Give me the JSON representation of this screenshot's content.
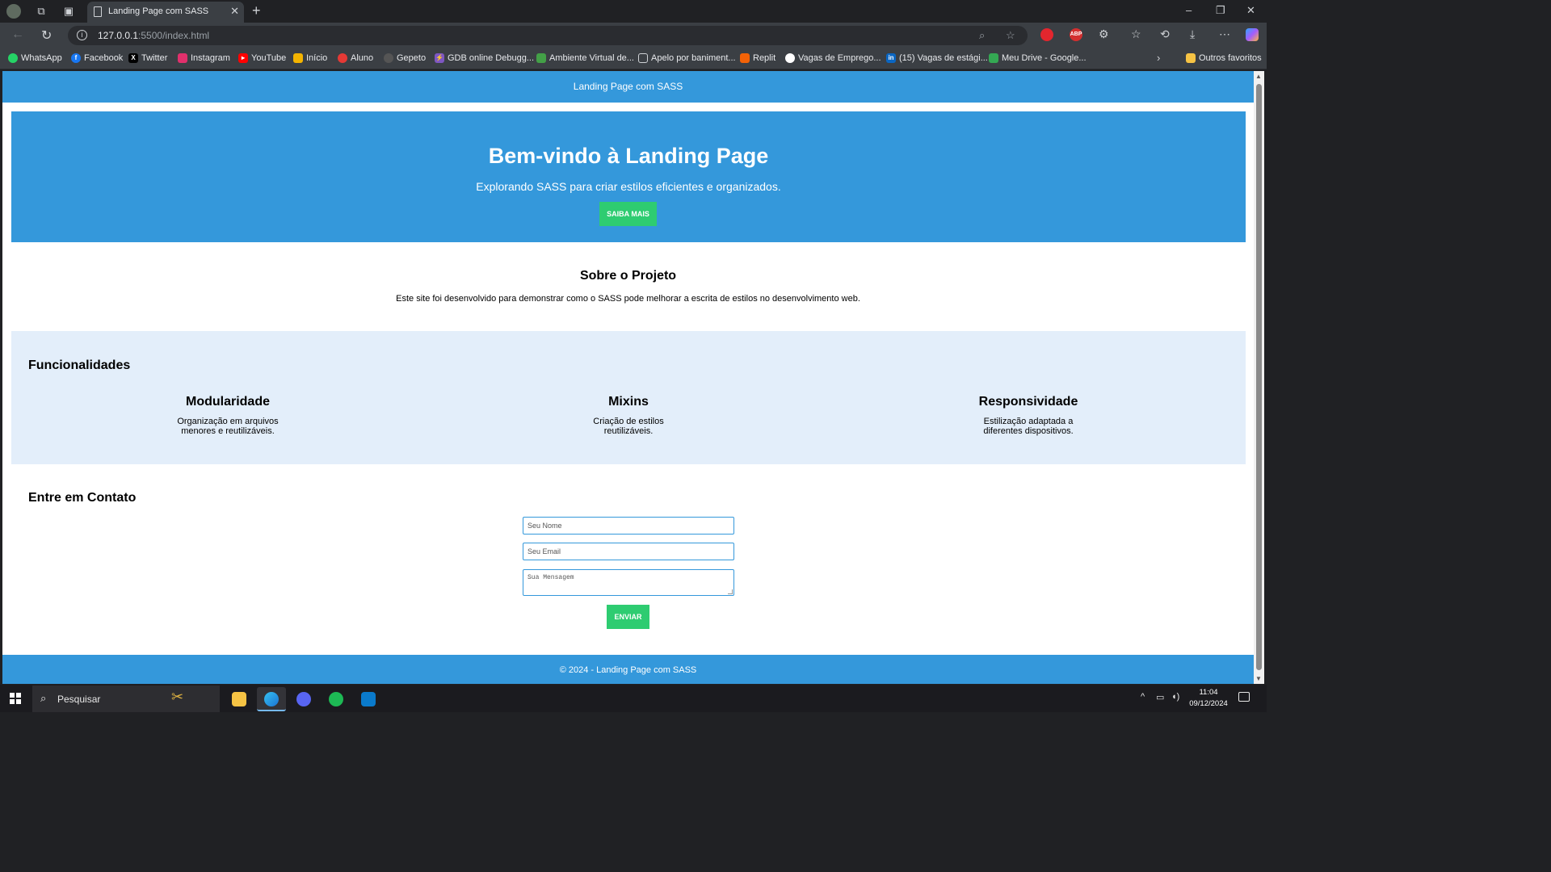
{
  "browser": {
    "tab_title": "Landing Page com SASS",
    "new_tab": "+",
    "url_host": "127.0.0.1",
    "url_path": ":5500/index.html",
    "extensions": [
      "opera-vpn",
      "ABP",
      "puzzle",
      "favorites",
      "history",
      "download",
      "more",
      "copilot"
    ],
    "window_controls": [
      "–",
      "❐",
      "✕"
    ]
  },
  "bookmarks": [
    {
      "label": "WhatsApp",
      "icon": "whatsapp-icon",
      "color": "#25d366"
    },
    {
      "label": "Facebook",
      "icon": "facebook-icon",
      "color": "#1877f2"
    },
    {
      "label": "Twitter",
      "icon": "x-icon",
      "color": "#000000"
    },
    {
      "label": "Instagram",
      "icon": "instagram-icon",
      "color": "#e1306c"
    },
    {
      "label": "YouTube",
      "icon": "youtube-icon",
      "color": "#ff0000"
    },
    {
      "label": "Início",
      "icon": "home-icon",
      "color": "#f4b400"
    },
    {
      "label": "Aluno",
      "icon": "aluno-icon",
      "color": "#e53935"
    },
    {
      "label": "Gepeto",
      "icon": "openai-icon",
      "color": "#555555"
    },
    {
      "label": "GDB online Debugg...",
      "icon": "gdb-icon",
      "color": "#7e57c2"
    },
    {
      "label": "Ambiente Virtual de...",
      "icon": "ava-icon",
      "color": "#43a047"
    },
    {
      "label": "Apelo por baniment...",
      "icon": "doc-icon",
      "color": "#9e9e9e"
    },
    {
      "label": "Replit",
      "icon": "replit-icon",
      "color": "#f26207"
    },
    {
      "label": "Vagas de Emprego...",
      "icon": "vagas-icon",
      "color": "#ffffff"
    },
    {
      "label": "(15) Vagas de estági...",
      "icon": "linkedin-icon",
      "color": "#0a66c2"
    },
    {
      "label": "Meu Drive - Google...",
      "icon": "drive-icon",
      "color": "#34a853"
    }
  ],
  "bookmarks_other": "Outros favoritos",
  "page": {
    "header": "Landing Page com SASS",
    "hero": {
      "title": "Bem-vindo à Landing Page",
      "subtitle": "Explorando SASS para criar estilos eficientes e organizados.",
      "button": "Saiba Mais"
    },
    "about": {
      "title": "Sobre o Projeto",
      "text": "Este site foi desenvolvido para demonstrar como o SASS pode melhorar a escrita de estilos no desenvolvimento web."
    },
    "features": {
      "title": "Funcionalidades",
      "items": [
        {
          "title": "Modularidade",
          "text": "Organização em arquivos menores e reutilizáveis."
        },
        {
          "title": "Mixins",
          "text": "Criação de estilos reutilizáveis."
        },
        {
          "title": "Responsividade",
          "text": "Estilização adaptada a diferentes dispositivos."
        }
      ]
    },
    "contact": {
      "title": "Entre em Contato",
      "name_placeholder": "Seu Nome",
      "email_placeholder": "Seu Email",
      "message_placeholder": "Sua Mensagem",
      "button": "Enviar"
    },
    "footer": "© 2024 - Landing Page com SASS"
  },
  "taskbar": {
    "search_placeholder": "Pesquisar",
    "apps": [
      "file-explorer-icon",
      "edge-icon",
      "discord-icon",
      "spotify-icon",
      "vscode-icon"
    ],
    "time": "11:04",
    "date": "09/12/2024"
  },
  "colors": {
    "primary": "#3498db",
    "accent": "#2ecc71",
    "features_bg": "#e3eefa"
  }
}
